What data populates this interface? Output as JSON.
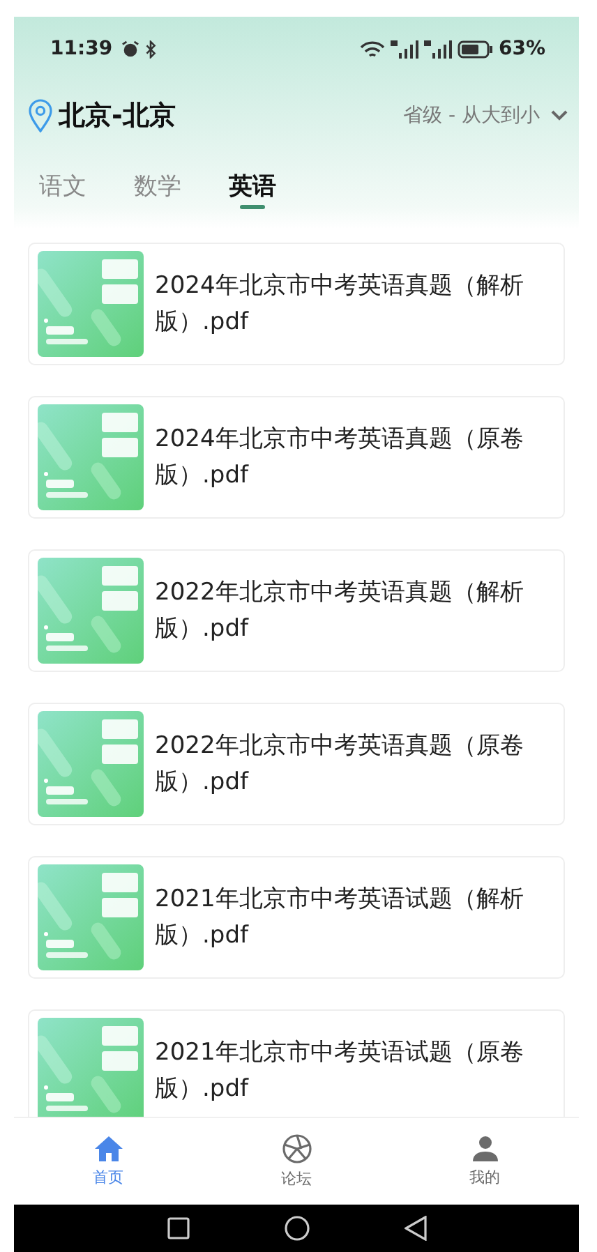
{
  "status_bar": {
    "time": "11:39",
    "battery": "63%"
  },
  "location": {
    "text": "北京-北京"
  },
  "sort": {
    "text": "省级 - 从大到小"
  },
  "tabs": [
    {
      "label": "语文",
      "selected": false
    },
    {
      "label": "数学",
      "selected": false
    },
    {
      "label": "英语",
      "selected": true
    }
  ],
  "files": [
    {
      "title": "2024年北京市中考英语真题（解析版）.pdf",
      "kind": "picture"
    },
    {
      "title": "2024年北京市中考英语真题（原卷版）.pdf",
      "kind": "picture"
    },
    {
      "title": "2022年北京市中考英语真题（解析版）.pdf",
      "kind": "picture"
    },
    {
      "title": "2022年北京市中考英语真题（原卷版）.pdf",
      "kind": "picture"
    },
    {
      "title": "2021年北京市中考英语试题（解析版）.pdf",
      "kind": "picture"
    },
    {
      "title": "2021年北京市中考英语试题（原卷版）.pdf",
      "kind": "picture"
    }
  ],
  "bottom_nav": [
    {
      "label": "首页",
      "kind": "home",
      "selected": true
    },
    {
      "label": "论坛",
      "kind": "forum",
      "selected": false
    },
    {
      "label": "我的",
      "kind": "profile",
      "selected": false
    }
  ]
}
